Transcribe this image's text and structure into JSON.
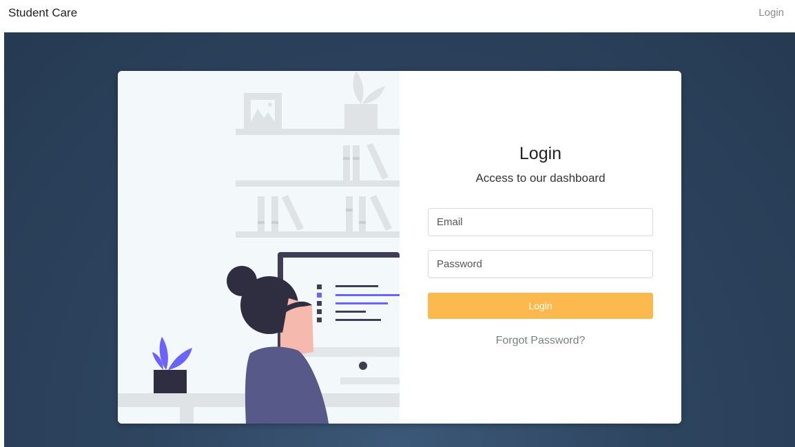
{
  "header": {
    "brand": "Student Care",
    "nav_login": "Login"
  },
  "login_card": {
    "title": "Login",
    "subtitle": "Access to our dashboard",
    "email_placeholder": "Email",
    "password_placeholder": "Password",
    "submit_label": "Login",
    "forgot_link": "Forgot Password?"
  },
  "colors": {
    "accent_button": "#fdb94d",
    "hero_background": "#2e4560",
    "illustration_purple": "#6c63ff"
  },
  "icons": {
    "illustration": "person-at-computer-illustration"
  }
}
